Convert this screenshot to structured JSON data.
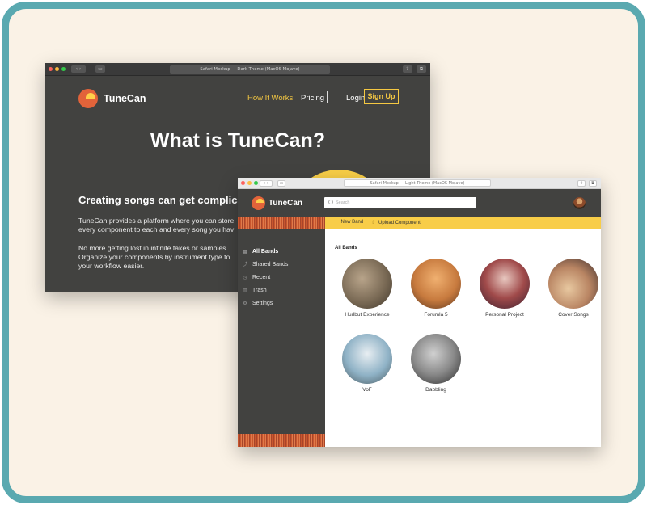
{
  "dark_window": {
    "title": "Safari Mockup — Dark Theme (MacOS Mojave)",
    "brand": "TuneCan",
    "nav": {
      "how_it_works": "How It Works",
      "pricing": "Pricing",
      "login": "Login",
      "sign_up": "Sign Up"
    },
    "headline": "What is TuneCan?",
    "subhead": "Creating songs can get complica",
    "paragraph1": [
      "TuneCan provides a platform where you can store",
      "every component to each and every song you hav"
    ],
    "paragraph2": [
      "No more getting lost in infinite takes or samples.",
      "Organize your components by instrument type to",
      "your workflow easier."
    ],
    "colors": {
      "bg": "#424240",
      "accent": "#f5c842"
    }
  },
  "light_window": {
    "title": "Safari Mockup — Light Theme (MacOS Mojave)",
    "brand": "TuneCan",
    "search": {
      "placeholder": "Search",
      "value": ""
    },
    "actions": {
      "new_band": "New Band",
      "upload_component": "Upload Component"
    },
    "sidebar": [
      {
        "label": "All Bands",
        "icon": "folder-icon",
        "active": true
      },
      {
        "label": "Shared Bands",
        "icon": "share-icon",
        "active": false
      },
      {
        "label": "Recent",
        "icon": "clock-icon",
        "active": false
      },
      {
        "label": "Trash",
        "icon": "trash-icon",
        "active": false
      },
      {
        "label": "Settings",
        "icon": "gear-icon",
        "active": false
      }
    ],
    "section_title": "All Bands",
    "bands": [
      {
        "name": "Hurlbut Experience",
        "color": "#7a6a55"
      },
      {
        "name": "Forumla 5",
        "color": "#c77a3e"
      },
      {
        "name": "Personal Project",
        "color": "#7a3b3a"
      },
      {
        "name": "Cover Songs",
        "color": "#b98563"
      },
      {
        "name": "VoF",
        "color": "#8fb2c6"
      },
      {
        "name": "Dabbling",
        "color": "#8a8a8a"
      }
    ],
    "colors": {
      "header": "#424240",
      "actionbar": "#f8cd48"
    }
  }
}
